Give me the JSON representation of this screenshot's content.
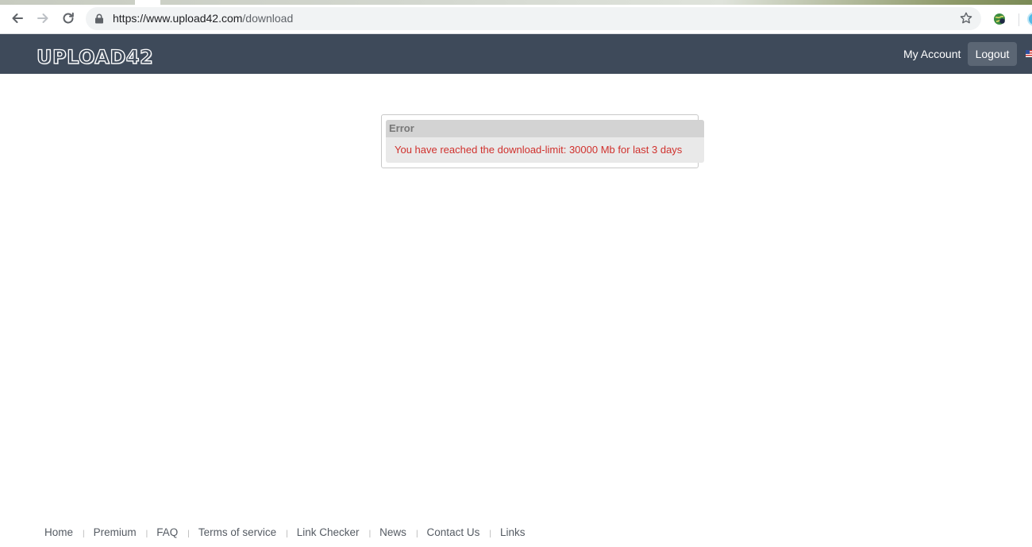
{
  "browser": {
    "url_host": "https://www.upload42.com",
    "url_path": "/download"
  },
  "header": {
    "logo": "UPLOAD42",
    "my_account": "My Account",
    "logout": "Logout"
  },
  "error": {
    "title": "Error",
    "message": "You have reached the download-limit: 30000 Mb for last 3 days"
  },
  "footer": {
    "links": [
      "Home",
      "Premium",
      "FAQ",
      "Terms of service",
      "Link Checker",
      "News",
      "Contact Us",
      "Links"
    ]
  },
  "colors": {
    "header_bg": "#3e4a5a",
    "error_text": "#d0312d"
  }
}
